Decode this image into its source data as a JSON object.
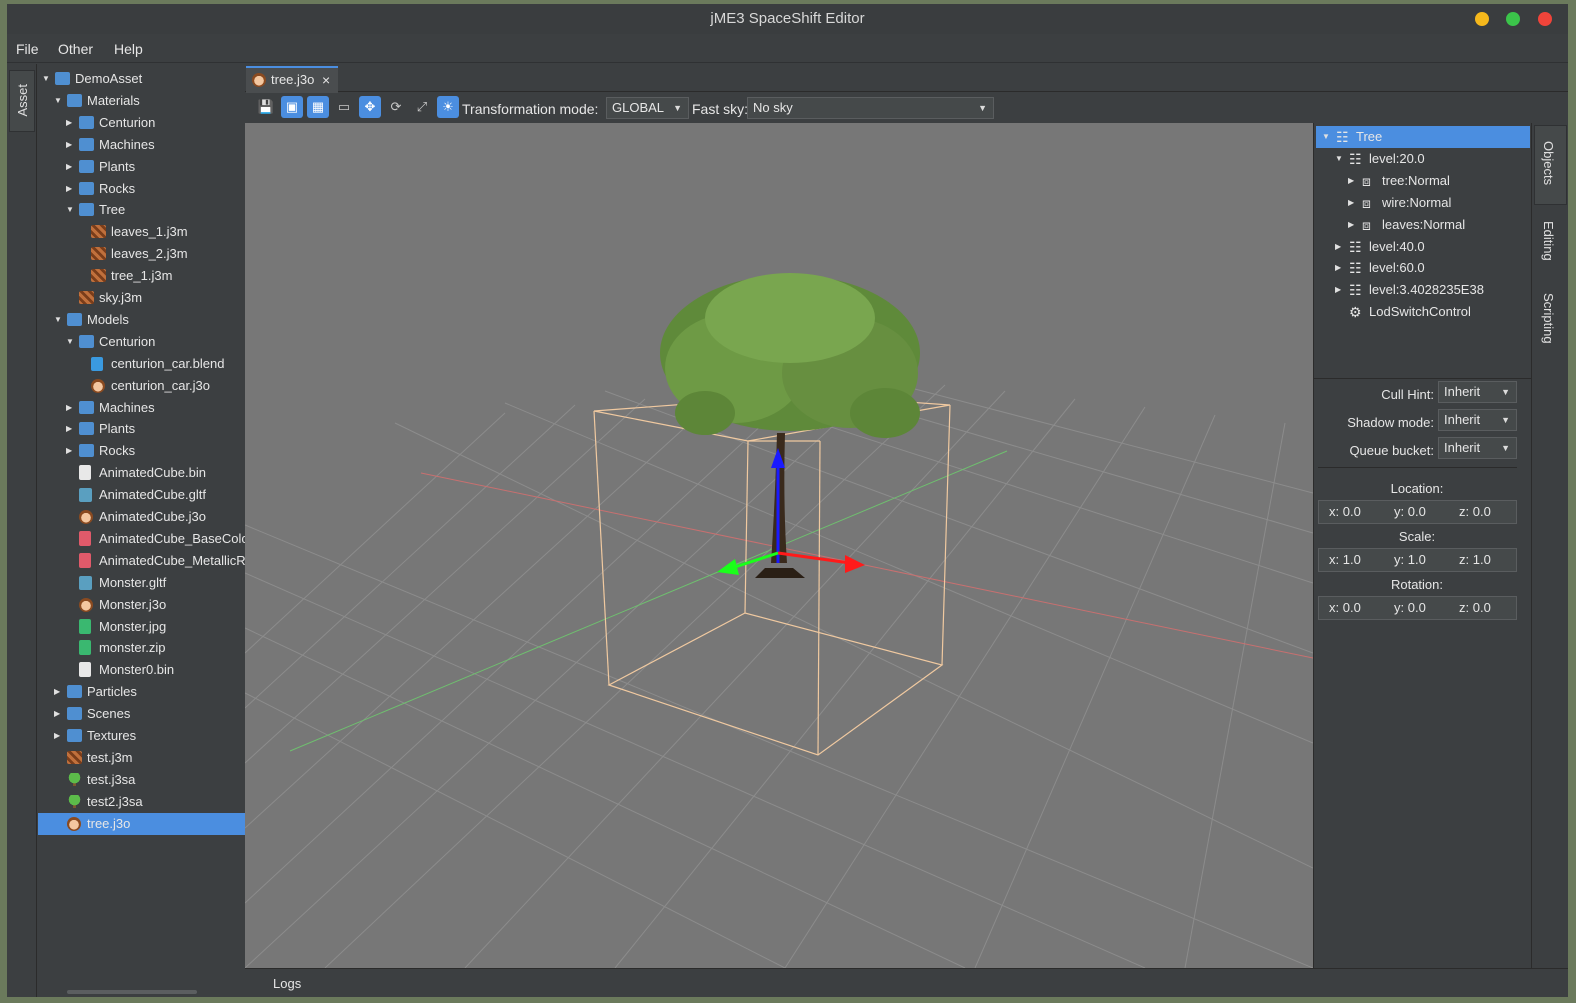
{
  "window": {
    "title": "jME3 SpaceShift Editor"
  },
  "menu": [
    "File",
    "Other",
    "Help"
  ],
  "left_tab": "Asset",
  "asset_tree": [
    {
      "label": "DemoAsset",
      "icon": "folder-icon",
      "expanded": true
    },
    {
      "label": "Materials",
      "icon": "folder-icon",
      "expanded": true
    },
    {
      "label": "Centurion",
      "icon": "folder-icon",
      "expanded": false
    },
    {
      "label": "Machines",
      "icon": "folder-icon",
      "expanded": false
    },
    {
      "label": "Plants",
      "icon": "folder-icon",
      "expanded": false
    },
    {
      "label": "Rocks",
      "icon": "folder-icon",
      "expanded": false
    },
    {
      "label": "Tree",
      "icon": "folder-icon",
      "expanded": true
    },
    {
      "label": "leaves_1.j3m",
      "icon": "material-icon"
    },
    {
      "label": "leaves_2.j3m",
      "icon": "material-icon"
    },
    {
      "label": "tree_1.j3m",
      "icon": "material-icon"
    },
    {
      "label": "sky.j3m",
      "icon": "material-icon"
    },
    {
      "label": "Models",
      "icon": "folder-icon",
      "expanded": true
    },
    {
      "label": "Centurion",
      "icon": "folder-icon",
      "expanded": true
    },
    {
      "label": "centurion_car.blend",
      "icon": "blend-file-icon"
    },
    {
      "label": "centurion_car.j3o",
      "icon": "j3o-model-icon"
    },
    {
      "label": "Machines",
      "icon": "folder-icon",
      "expanded": false
    },
    {
      "label": "Plants",
      "icon": "folder-icon",
      "expanded": false
    },
    {
      "label": "Rocks",
      "icon": "folder-icon",
      "expanded": false
    },
    {
      "label": "AnimatedCube.bin",
      "icon": "file-icon"
    },
    {
      "label": "AnimatedCube.gltf",
      "icon": "gltf-icon"
    },
    {
      "label": "AnimatedCube.j3o",
      "icon": "j3o-model-icon"
    },
    {
      "label": "AnimatedCube_BaseColor",
      "icon": "image-icon"
    },
    {
      "label": "AnimatedCube_MetallicR",
      "icon": "image-icon"
    },
    {
      "label": "Monster.gltf",
      "icon": "gltf-icon"
    },
    {
      "label": "Monster.j3o",
      "icon": "j3o-model-icon"
    },
    {
      "label": "Monster.jpg",
      "icon": "jpg-icon"
    },
    {
      "label": "monster.zip",
      "icon": "zip-icon"
    },
    {
      "label": "Monster0.bin",
      "icon": "file-icon"
    },
    {
      "label": "Particles",
      "icon": "folder-icon",
      "expanded": false
    },
    {
      "label": "Scenes",
      "icon": "folder-icon",
      "expanded": false
    },
    {
      "label": "Textures",
      "icon": "folder-icon",
      "expanded": false
    },
    {
      "label": "test.j3m",
      "icon": "material-icon"
    },
    {
      "label": "test.j3sa",
      "icon": "tree-asset-icon"
    },
    {
      "label": "test2.j3sa",
      "icon": "tree-asset-icon"
    },
    {
      "label": "tree.j3o",
      "icon": "j3o-model-icon",
      "selected": true
    }
  ],
  "editor_tab": {
    "label": "tree.j3o",
    "close": "×"
  },
  "toolbar": {
    "transform_label": "Transformation mode:",
    "transform_value": "GLOBAL",
    "sky_label": "Fast sky:",
    "sky_value": "No sky"
  },
  "objects_tree": [
    {
      "label": "Tree",
      "icon": "node-icon",
      "expanded": true,
      "selected": true
    },
    {
      "label": "level:20.0",
      "icon": "node-icon",
      "expanded": true
    },
    {
      "label": "tree:Normal",
      "icon": "geometry-icon",
      "expanded": false
    },
    {
      "label": "wire:Normal",
      "icon": "geometry-icon",
      "expanded": false
    },
    {
      "label": "leaves:Normal",
      "icon": "geometry-icon",
      "expanded": false
    },
    {
      "label": "level:40.0",
      "icon": "node-icon",
      "expanded": false
    },
    {
      "label": "level:60.0",
      "icon": "node-icon",
      "expanded": false
    },
    {
      "label": "level:3.4028235E38",
      "icon": "node-icon",
      "expanded": false
    },
    {
      "label": "LodSwitchControl",
      "icon": "control-icon"
    }
  ],
  "properties": {
    "cull_hint_label": "Cull Hint:",
    "cull_hint_value": "Inherit",
    "shadow_mode_label": "Shadow mode:",
    "shadow_mode_value": "Inherit",
    "queue_bucket_label": "Queue bucket:",
    "queue_bucket_value": "Inherit",
    "location_label": "Location:",
    "location": {
      "x": "x: 0.0",
      "y": "y: 0.0",
      "z": "z: 0.0"
    },
    "scale_label": "Scale:",
    "scale": {
      "x": "x: 1.0",
      "y": "y: 1.0",
      "z": "z: 1.0"
    },
    "rotation_label": "Rotation:",
    "rotation": {
      "x": "x: 0.0",
      "y": "y: 0.0",
      "z": "z: 0.0"
    }
  },
  "right_tabs": [
    "Objects",
    "Editing",
    "Scripting"
  ],
  "status": {
    "logs_label": "Logs"
  },
  "colors": {
    "accent": "#4b8ee0",
    "background": "#3c3f41",
    "viewport": "#777777"
  }
}
